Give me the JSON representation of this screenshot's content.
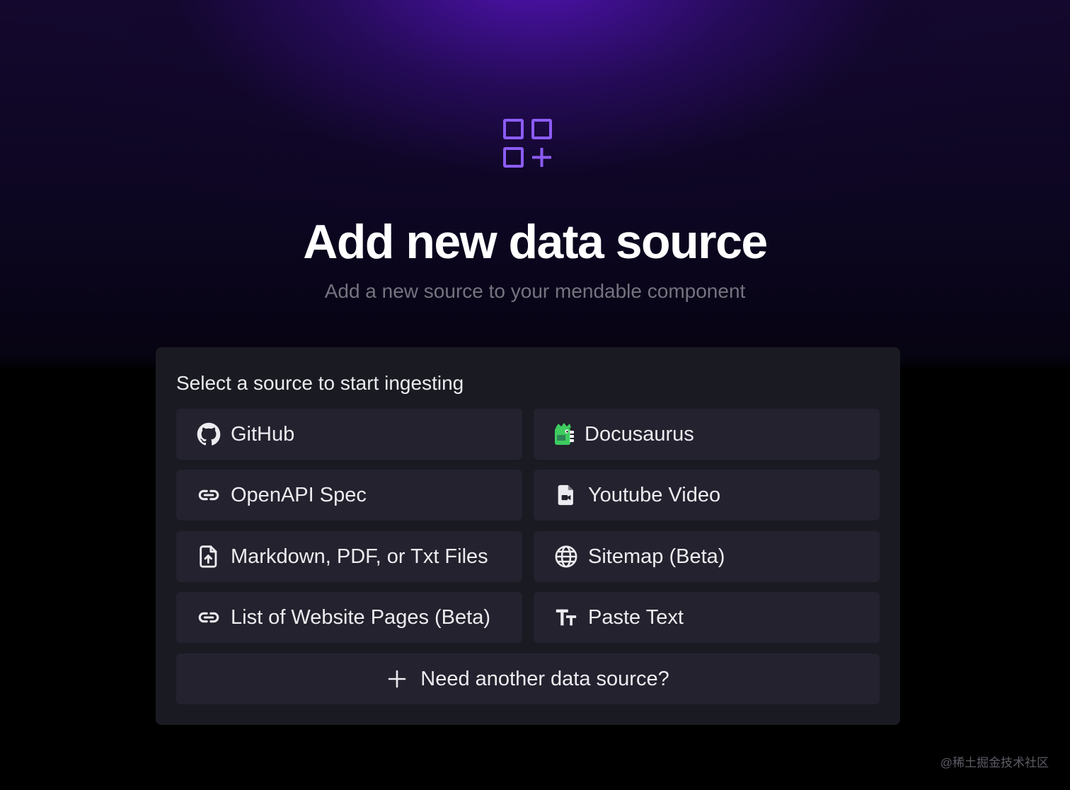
{
  "hero": {
    "icon": "grid-plus-icon",
    "title": "Add new data source",
    "subtitle": "Add a new source to your mendable component"
  },
  "colors": {
    "accent": "#8b5cf6",
    "card_bg": "#1a1a22",
    "item_bg": "#23222e",
    "text": "#ececf0",
    "subtitle": "#74737f"
  },
  "panel": {
    "heading": "Select a source to start ingesting",
    "sources": [
      {
        "label": "GitHub",
        "icon": "github-icon"
      },
      {
        "label": "Docusaurus",
        "icon": "docusaurus-icon"
      },
      {
        "label": "OpenAPI Spec",
        "icon": "link-icon"
      },
      {
        "label": "Youtube Video",
        "icon": "file-video-icon"
      },
      {
        "label": "Markdown, PDF, or Txt Files",
        "icon": "file-upload-icon"
      },
      {
        "label": "Sitemap (Beta)",
        "icon": "globe-icon"
      },
      {
        "label": "List of Website Pages (Beta)",
        "icon": "link-icon"
      },
      {
        "label": "Paste Text",
        "icon": "text-size-icon"
      }
    ],
    "another": {
      "label": "Need another data source?",
      "icon": "plus-icon"
    }
  },
  "watermark": "@稀土掘金技术社区"
}
